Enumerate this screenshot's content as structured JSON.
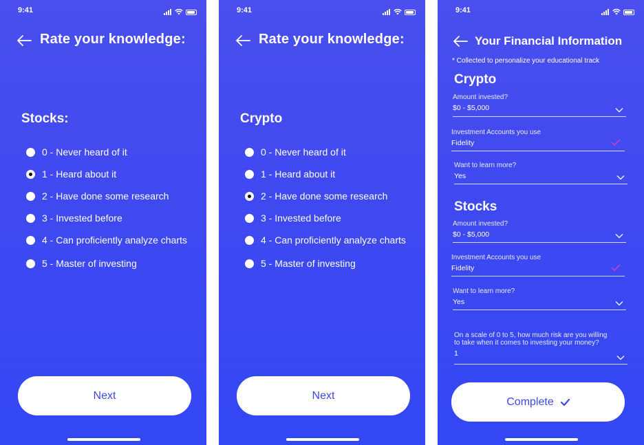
{
  "status": {
    "time": "9:41"
  },
  "screen1": {
    "title": "Rate your knowledge:",
    "section": "Stocks:",
    "options": [
      "0 - Never heard of it",
      "1 - Heard about it",
      "2 - Have done some research",
      "3 - Invested before",
      "4 - Can proficiently analyze charts",
      "5 - Master of investing"
    ],
    "selected_index": 1,
    "next_label": "Next"
  },
  "screen2": {
    "title": "Rate your knowledge:",
    "section": "Crypto",
    "options": [
      "0 - Never heard of it",
      "1 - Heard about it",
      "2 - Have done some research",
      "3 - Invested before",
      "4 - Can proficiently analyze charts",
      "5 - Master of investing"
    ],
    "selected_index": 2,
    "next_label": "Next"
  },
  "screen3": {
    "title": "Your Financial Information",
    "note": "* Collected to personalize your educational track",
    "crypto": {
      "heading": "Crypto",
      "amount_label": "Amount invested?",
      "amount_value": "$0 - $5,000",
      "accounts_label": "Investment Accounts you use",
      "accounts_value": "Fidelity",
      "learn_label": "Want to learn more?",
      "learn_value": "Yes"
    },
    "stocks": {
      "heading": "Stocks",
      "amount_label": "Amount invested?",
      "amount_value": "$0 - $5,000",
      "accounts_label": "Investment Accounts you use",
      "accounts_value": "Fidelity",
      "learn_label": "Want to learn more?",
      "learn_value": "Yes"
    },
    "risk_label_1": "On a scale of 0 to 5, how much risk are you willing",
    "risk_label_2": "to take when it comes to investing your money?",
    "risk_value": "1",
    "complete_label": "Complete"
  },
  "colors": {
    "accent": "#3d48e8",
    "check": "#e040c8"
  }
}
